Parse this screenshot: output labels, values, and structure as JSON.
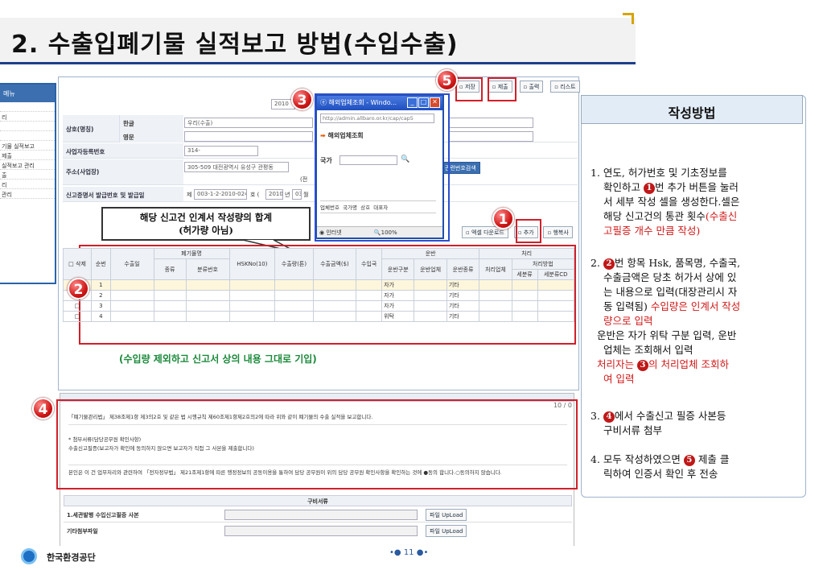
{
  "title": "2. 수출입폐기물 실적보고 방법(수입수출)",
  "menu": {
    "header": "메뉴",
    "items": [
      "",
      "리",
      "",
      "",
      "기물 실적보고",
      "제출",
      "실적보고 관리",
      "출",
      "리",
      "관리"
    ]
  },
  "toolbar": {
    "buttons": [
      "저장",
      "제출",
      "출력",
      "리스트"
    ]
  },
  "form": {
    "year": "2010",
    "name_label": "상호(명칭)",
    "kor_label": "한글",
    "kor_value": "우리(수출)",
    "eng_label": "영문",
    "eng_value": "",
    "biz_label": "사업자등록번호",
    "biz_value": "314-",
    "addr_label": "주소(사업장)",
    "addr_value": "305-509  대전광역시 유성구 관평동",
    "tel_label": "(전",
    "cert_label": "신고증명서 발급번호 및 발급일",
    "cert_prefix": "제",
    "cert_value": "003-1-2-2010-024",
    "cert_suffix": "호 (",
    "cert_year": "2010",
    "cert_year_unit": "년",
    "cert_month": "03",
    "cert_month_unit": "월",
    "search_button": "관련번호검색"
  },
  "popup": {
    "title": "해외업체조회 - Windo...",
    "url": "http://admin.allbaro.or.kr/cap/cap5",
    "heading": "해외업체조회",
    "country_label": "국가",
    "cols": [
      "업체번호",
      "국가명",
      "상호",
      "대표자"
    ],
    "status": "인터넷",
    "zoom": "100%"
  },
  "callout": {
    "line1": "해당 신고건 인계서  작성량의 합계",
    "line2": "(허가량 아님)"
  },
  "grid_buttons": [
    "엑셀 다운로드",
    "추가",
    "행복사"
  ],
  "grid": {
    "top": [
      "삭제",
      "순번",
      "수출일",
      "폐기물명",
      "HSKNo(10)",
      "수출량(톤)",
      "수출금액($)",
      "수입국",
      "운반",
      "처리"
    ],
    "waste_sub": [
      "종류",
      "분류번호"
    ],
    "transport_sub": [
      "운반구분",
      "운반업체",
      "운반종류"
    ],
    "treat_sub": [
      "처리업체",
      "처리방법"
    ],
    "method_sub": [
      "세분류",
      "세분류CD"
    ],
    "rows": [
      {
        "no": "1",
        "transport": "자가",
        "kind": "기타"
      },
      {
        "no": "2",
        "transport": "자가",
        "kind": "기타"
      },
      {
        "no": "3",
        "transport": "자가",
        "kind": "기타"
      },
      {
        "no": "4",
        "transport": "위탁",
        "kind": "기타"
      }
    ]
  },
  "note": "(수입량 제외하고 신고서 상의 내용 그대로 기입)",
  "doc": {
    "page": "10 / 0",
    "p1": "「폐기물관리법」 제38조제1항 제3의2호 및 같은 법 시행규칙 제60조제1항제2호의2에 따라 위와 같이 폐기물의 수출 실적을 보고합니다.",
    "p2a": "* 첨부서류(담당공무원 확인사항)",
    "p2b": "수출신고필증(보고자가 확인에 동의하지 않으면 보고자가 직접 그 사본을 제출합니다)",
    "p3": "본인은 이 건 업무처리와 관련하여 「전자정부법」 제21조제1항에 따른 행정정보의 공동이용을 통하여 담당 공무원이 위의 담당 공무원 확인사항을 확인하는 것에 ●동의 합니다.○동의하지 않습니다.",
    "req_header": "구비서류",
    "req1": "1.세관발행 수입신고필증 사본",
    "req2": "기타첨부파일",
    "upload": "파일 UpLoad"
  },
  "side": {
    "header": "작성방법",
    "s1a": "1. 연도, 허가번호  및 기초정보를",
    "s1b": "확인하고",
    "s1c": "번 추가 버튼을 눌러",
    "s1d": "서 세부 작성 셀을 생성한다.셀은",
    "s1e": "해당 신고건의 통관 횟수",
    "s1f": "(수출신",
    "s1g": "고필증 개수 만큼 작성)",
    "s2a": "2.",
    "s2b": "번 항목 Hsk, 품목명, 수출국,",
    "s2c": "수출금액은 당초 허가서 상에 있",
    "s2d": "는 내용으로 입력(대장관리시 자",
    "s2e": "동 입력됨)",
    "s2f": "수입량은 인계서 작성",
    "s2g": "량으로 입력",
    "s2h": "운반은 자가 위탁 구분 입력, 운반",
    "s2i": "업체는 조회해서 입력",
    "s2j": "처리자는",
    "s2k": "의 처리업체 조회하",
    "s2l": "여 입력",
    "s3a": "3.",
    "s3b": "에서 수출신고 필증 사본등",
    "s3c": "구비서류 첨부",
    "s4a": "4. 모두 작성하였으면",
    "s4b": "제출  클",
    "s4c": "릭하여 인증서 확인 후 전송"
  },
  "footer": {
    "org": "한국환경공단",
    "page": "11"
  },
  "badges": [
    "1",
    "2",
    "3",
    "4",
    "5"
  ]
}
